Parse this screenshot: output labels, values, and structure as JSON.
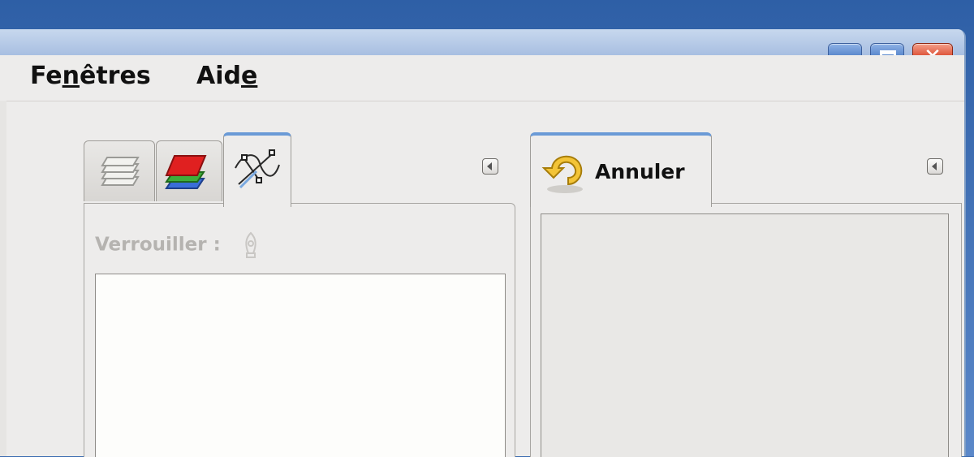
{
  "menubar": {
    "items": [
      {
        "pre": "Fe",
        "accel": "n",
        "post": "êtres"
      },
      {
        "pre": "Aid",
        "accel": "e",
        "post": ""
      }
    ]
  },
  "left_dock": {
    "tabs": [
      {
        "icon": "layers-icon"
      },
      {
        "icon": "channels-icon"
      },
      {
        "icon": "paths-icon",
        "active": true
      }
    ],
    "lock_label": "Verrouiller :"
  },
  "right_dock": {
    "tab_label": "Annuler",
    "tab_icon": "undo-icon"
  },
  "colors": {
    "titlebar": "#a9c0e2",
    "tab_highlight": "#6a9ad6",
    "close_button": "#d9452a"
  }
}
